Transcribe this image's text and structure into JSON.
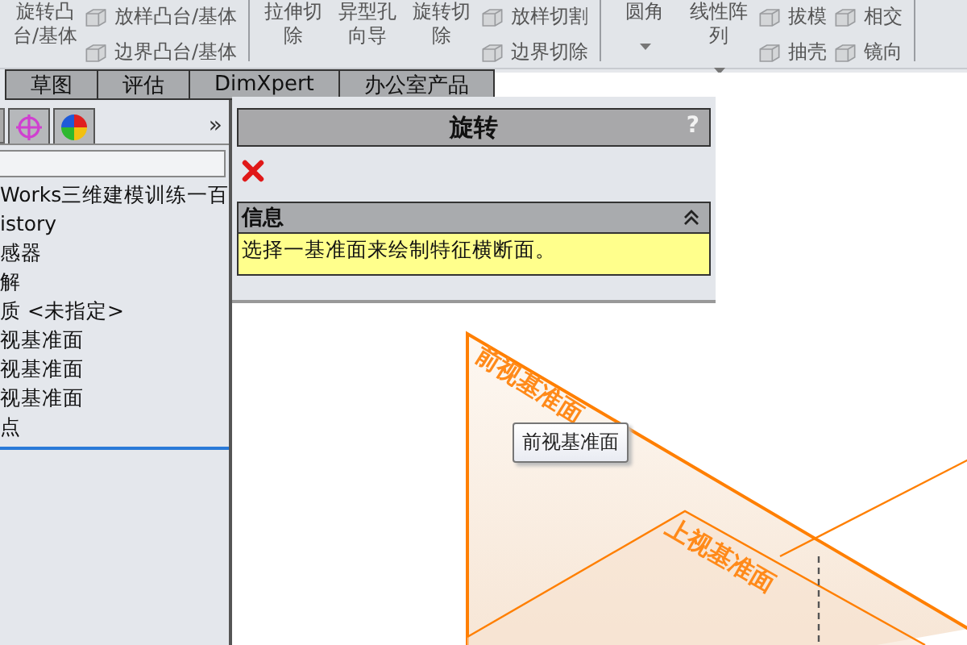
{
  "toolbar": {
    "columns": [
      {
        "kind": "large",
        "label": "旋转凸台/基体",
        "dropdown": false
      },
      {
        "kind": "stack",
        "items": [
          {
            "label": "放样凸台/基体"
          },
          {
            "label": "边界凸台/基体"
          }
        ]
      },
      {
        "kind": "divider"
      },
      {
        "kind": "large",
        "label": "拉伸切除",
        "dropdown": false
      },
      {
        "kind": "large",
        "label": "异型孔向导",
        "dropdown": false
      },
      {
        "kind": "large",
        "label": "旋转切除",
        "dropdown": false
      },
      {
        "kind": "stack",
        "items": [
          {
            "label": "放样切割"
          },
          {
            "label": "边界切除"
          }
        ]
      },
      {
        "kind": "divider"
      },
      {
        "kind": "large",
        "label": "圆角",
        "dropdown": true
      },
      {
        "kind": "large",
        "label": "线性阵列",
        "dropdown": true
      },
      {
        "kind": "stack",
        "items": [
          {
            "label": "拔模"
          },
          {
            "label": "抽壳"
          }
        ]
      },
      {
        "kind": "stack",
        "items": [
          {
            "label": "相交"
          },
          {
            "label": "镜向"
          }
        ]
      },
      {
        "kind": "divider"
      }
    ]
  },
  "tabs": [
    {
      "label": "草图",
      "selected": false
    },
    {
      "label": "评估",
      "selected": false
    },
    {
      "label": "DimXpert",
      "selected": false
    },
    {
      "label": "办公室产品",
      "selected": false
    }
  ],
  "feature_panel": {
    "more": "»",
    "tree": [
      {
        "label": "Works三维建模训练一百"
      },
      {
        "label": "istory"
      },
      {
        "label": "感器"
      },
      {
        "label": "解"
      },
      {
        "label": "质 <未指定>"
      },
      {
        "label": "视基准面"
      },
      {
        "label": "视基准面"
      },
      {
        "label": "视基准面"
      },
      {
        "label": "点"
      }
    ]
  },
  "property_manager": {
    "title": "旋转",
    "help": "?",
    "info": {
      "title": "信息",
      "expanded": true,
      "message": "选择一基准面来绘制特征横断面。"
    }
  },
  "viewport": {
    "planes": [
      {
        "label": "前视基准面"
      },
      {
        "label": "上视基准面"
      }
    ],
    "tooltip": "前视基准面"
  }
}
